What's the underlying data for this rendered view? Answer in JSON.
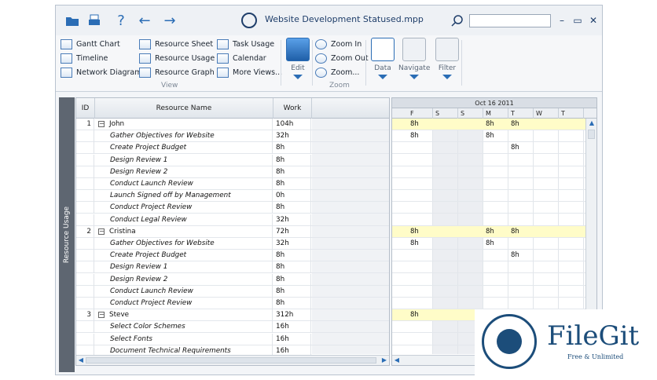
{
  "window": {
    "title": "Website Development Statused.mpp",
    "search_placeholder": ""
  },
  "toolbar": {
    "icons": [
      "open-folder-icon",
      "print-icon",
      "help-icon",
      "back-arrow-icon",
      "forward-arrow-icon",
      "search-icon"
    ],
    "min": "–",
    "restore": "▭",
    "close": "✕"
  },
  "ribbon": {
    "view_items": [
      "Gantt Chart",
      "Timeline",
      "Network Diagram",
      "Resource Sheet",
      "Resource Usage",
      "Resource Graph",
      "Task Usage",
      "Calendar",
      "More Views..."
    ],
    "view_label": "View",
    "edit_label": "Edit",
    "zoom_in": "Zoom In",
    "zoom_out": "Zoom Out",
    "zoom": "Zoom...",
    "zoom_label": "Zoom",
    "data_label": "Data",
    "navigate_label": "Navigate",
    "filter_label": "Filter"
  },
  "sidebar": {
    "label": "Resource Usage"
  },
  "grid": {
    "headers": {
      "id": "ID",
      "name": "Resource Name",
      "work": "Work"
    },
    "rows": [
      {
        "type": "res",
        "id": "1",
        "name": "John",
        "work": "104h"
      },
      {
        "type": "task",
        "id": "",
        "name": "Gather Objectives for Website",
        "work": "32h"
      },
      {
        "type": "task",
        "id": "",
        "name": "Create Project Budget",
        "work": "8h"
      },
      {
        "type": "task",
        "id": "",
        "name": "Design Review 1",
        "work": "8h"
      },
      {
        "type": "task",
        "id": "",
        "name": "Design Review 2",
        "work": "8h"
      },
      {
        "type": "task",
        "id": "",
        "name": "Conduct Launch Review",
        "work": "8h"
      },
      {
        "type": "task",
        "id": "",
        "name": "Launch Signed off by Management",
        "work": "0h"
      },
      {
        "type": "task",
        "id": "",
        "name": "Conduct Project Review",
        "work": "8h"
      },
      {
        "type": "task",
        "id": "",
        "name": "Conduct Legal Review",
        "work": "32h"
      },
      {
        "type": "res",
        "id": "2",
        "name": "Cristina",
        "work": "72h"
      },
      {
        "type": "task",
        "id": "",
        "name": "Gather Objectives for Website",
        "work": "32h"
      },
      {
        "type": "task",
        "id": "",
        "name": "Create Project Budget",
        "work": "8h"
      },
      {
        "type": "task",
        "id": "",
        "name": "Design Review 1",
        "work": "8h"
      },
      {
        "type": "task",
        "id": "",
        "name": "Design Review 2",
        "work": "8h"
      },
      {
        "type": "task",
        "id": "",
        "name": "Conduct Launch Review",
        "work": "8h"
      },
      {
        "type": "task",
        "id": "",
        "name": "Conduct Project Review",
        "work": "8h"
      },
      {
        "type": "res",
        "id": "3",
        "name": "Steve",
        "work": "312h"
      },
      {
        "type": "task",
        "id": "",
        "name": "Select Color Schemes",
        "work": "16h"
      },
      {
        "type": "task",
        "id": "",
        "name": "Select Fonts",
        "work": "16h"
      },
      {
        "type": "task",
        "id": "",
        "name": "Document Technical Requirements",
        "work": "16h"
      }
    ]
  },
  "gantt": {
    "week_label": "Oct 16 2011",
    "days": [
      "F",
      "S",
      "S",
      "M",
      "T",
      "W",
      "T"
    ],
    "values": [
      [
        "8h",
        "",
        "",
        "8h",
        "8h",
        "",
        ""
      ],
      [
        "8h",
        "",
        "",
        "8h",
        "",
        "",
        ""
      ],
      [
        "",
        "",
        "",
        "",
        "8h",
        "",
        ""
      ],
      [
        "",
        "",
        "",
        "",
        "",
        "",
        ""
      ],
      [
        "",
        "",
        "",
        "",
        "",
        "",
        ""
      ],
      [
        "",
        "",
        "",
        "",
        "",
        "",
        ""
      ],
      [
        "",
        "",
        "",
        "",
        "",
        "",
        ""
      ],
      [
        "",
        "",
        "",
        "",
        "",
        "",
        ""
      ],
      [
        "",
        "",
        "",
        "",
        "",
        "",
        ""
      ],
      [
        "8h",
        "",
        "",
        "8h",
        "8h",
        "",
        ""
      ],
      [
        "8h",
        "",
        "",
        "8h",
        "",
        "",
        ""
      ],
      [
        "",
        "",
        "",
        "",
        "8h",
        "",
        ""
      ],
      [
        "",
        "",
        "",
        "",
        "",
        "",
        ""
      ],
      [
        "",
        "",
        "",
        "",
        "",
        "",
        ""
      ],
      [
        "",
        "",
        "",
        "",
        "",
        "",
        ""
      ],
      [
        "",
        "",
        "",
        "",
        "",
        "",
        ""
      ],
      [
        "8h",
        "",
        "",
        "",
        "",
        "",
        ""
      ],
      [
        "",
        "",
        "",
        "",
        "",
        "",
        ""
      ],
      [
        "",
        "",
        "",
        "",
        "",
        "",
        ""
      ],
      [
        "",
        "",
        "",
        "",
        "",
        "",
        ""
      ]
    ]
  },
  "watermark": {
    "title": "FileGit",
    "subtitle": "Free & Unlimited"
  }
}
